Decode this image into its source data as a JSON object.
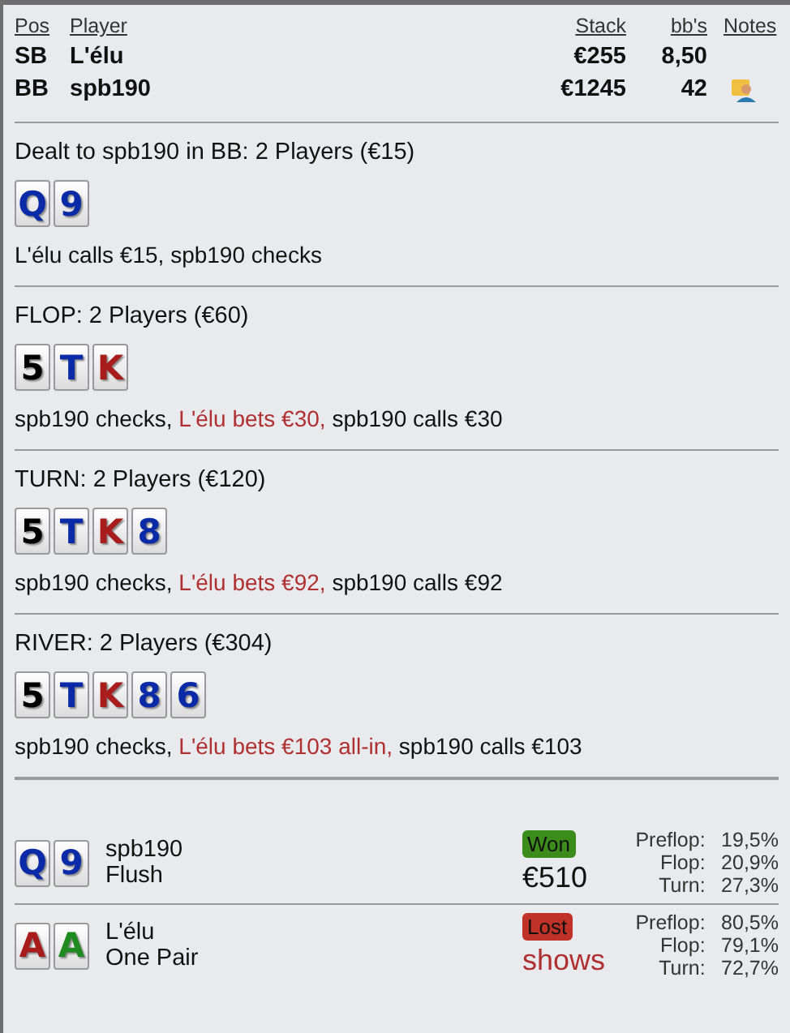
{
  "players": {
    "columns": [
      "Pos",
      "Player",
      "Stack",
      "bb's",
      "Notes"
    ],
    "rows": [
      {
        "pos": "SB",
        "player": "L'élu",
        "stack": "€255",
        "bbs": "8,50",
        "has_note": false
      },
      {
        "pos": "BB",
        "player": "spb190",
        "stack": "€1245",
        "bbs": "42",
        "has_note": true
      }
    ]
  },
  "streets": [
    {
      "title": "Dealt to spb190 in BB: 2 Players (€15)",
      "cards": [
        {
          "rank": "Q",
          "color": "#0a2aa8"
        },
        {
          "rank": "9",
          "color": "#0a2aa8"
        }
      ],
      "actions": [
        {
          "text": "L'élu calls €15, spb190 checks",
          "highlight": false
        }
      ]
    },
    {
      "title": "FLOP: 2 Players (€60)",
      "cards": [
        {
          "rank": "5",
          "color": "#000000"
        },
        {
          "rank": "T",
          "color": "#0a2aa8"
        },
        {
          "rank": "K",
          "color": "#a81c1c"
        }
      ],
      "actions": [
        {
          "text": "spb190 checks, ",
          "highlight": false
        },
        {
          "text": "L'élu bets €30,",
          "highlight": true
        },
        {
          "text": " spb190 calls €30",
          "highlight": false
        }
      ]
    },
    {
      "title": "TURN: 2 Players (€120)",
      "cards": [
        {
          "rank": "5",
          "color": "#000000"
        },
        {
          "rank": "T",
          "color": "#0a2aa8"
        },
        {
          "rank": "K",
          "color": "#a81c1c"
        },
        {
          "rank": "8",
          "color": "#0a2aa8"
        }
      ],
      "actions": [
        {
          "text": "spb190 checks, ",
          "highlight": false
        },
        {
          "text": "L'élu bets €92,",
          "highlight": true
        },
        {
          "text": " spb190 calls €92",
          "highlight": false
        }
      ]
    },
    {
      "title": "RIVER: 2 Players (€304)",
      "cards": [
        {
          "rank": "5",
          "color": "#000000"
        },
        {
          "rank": "T",
          "color": "#0a2aa8"
        },
        {
          "rank": "K",
          "color": "#a81c1c"
        },
        {
          "rank": "8",
          "color": "#0a2aa8"
        },
        {
          "rank": "6",
          "color": "#0a2aa8"
        }
      ],
      "actions": [
        {
          "text": "spb190 checks, ",
          "highlight": false
        },
        {
          "text": "L'élu bets €103 all-in,",
          "highlight": true
        },
        {
          "text": " spb190 calls €103",
          "highlight": false
        }
      ]
    }
  ],
  "results": [
    {
      "cards": [
        {
          "rank": "Q",
          "color": "#0a2aa8"
        },
        {
          "rank": "9",
          "color": "#0a2aa8"
        }
      ],
      "player": "spb190",
      "hand": "Flush",
      "won": true,
      "badge": "Won",
      "amount": "€510",
      "equity": [
        {
          "label": "Preflop:",
          "value": "19,5%"
        },
        {
          "label": "Flop:",
          "value": "20,9%"
        },
        {
          "label": "Turn:",
          "value": "27,3%"
        }
      ]
    },
    {
      "cards": [
        {
          "rank": "A",
          "color": "#a81c1c"
        },
        {
          "rank": "A",
          "color": "#1f8a1f"
        }
      ],
      "player": "L'élu",
      "hand": "One Pair",
      "won": false,
      "badge": "Lost",
      "amount": "shows",
      "equity": [
        {
          "label": "Preflop:",
          "value": "80,5%"
        },
        {
          "label": "Flop:",
          "value": "79,1%"
        },
        {
          "label": "Turn:",
          "value": "72,7%"
        }
      ]
    }
  ]
}
